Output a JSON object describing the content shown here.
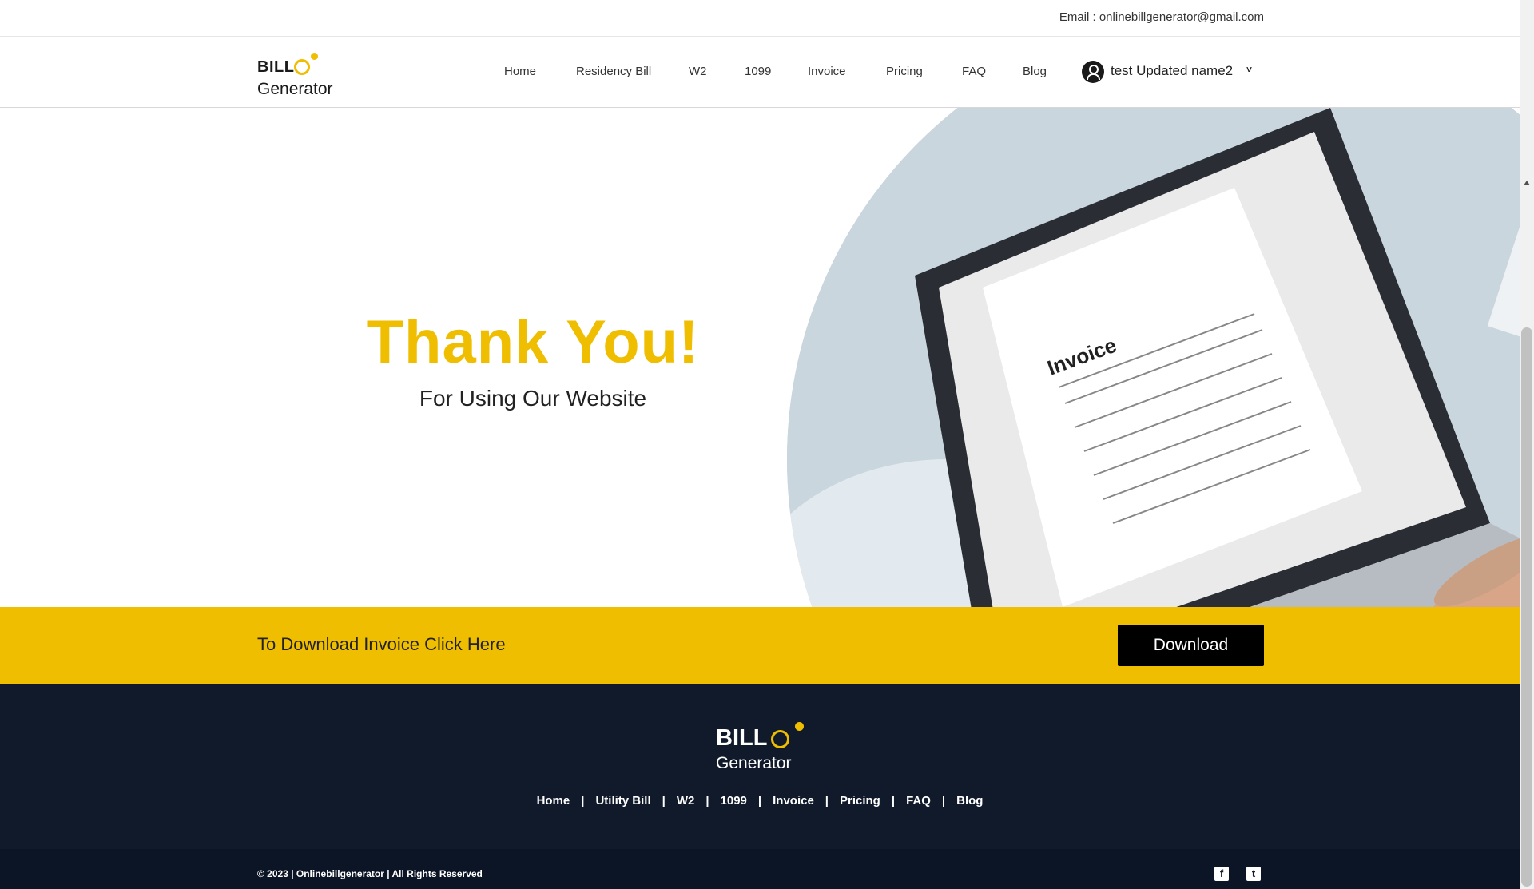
{
  "topbar": {
    "email": "Email : onlinebillgenerator@gmail.com"
  },
  "brand": {
    "name": "BILL",
    "sub": "Generator",
    "accent": "#f0be00"
  },
  "nav": {
    "items": [
      "Home",
      "Residency Bill",
      "W2",
      "1099",
      "Invoice",
      "Pricing",
      "FAQ",
      "Blog"
    ],
    "user_name": "test Updated name2"
  },
  "hero": {
    "title": "Thank You!",
    "subtitle": "For Using Our Website",
    "image_icon": "invoice-laptop-photo"
  },
  "cta": {
    "text": "To Download Invoice Click Here",
    "button": "Download"
  },
  "footer": {
    "brand": "BILL",
    "brand_sub": "Generator",
    "links": [
      "Home",
      "Utility Bill",
      "W2",
      "1099",
      "Invoice",
      "Pricing",
      "FAQ",
      "Blog"
    ],
    "copyright": "© 2023 | Onlinebillgenerator | All Rights Reserved",
    "social": [
      "facebook-icon",
      "twitter-icon"
    ]
  }
}
